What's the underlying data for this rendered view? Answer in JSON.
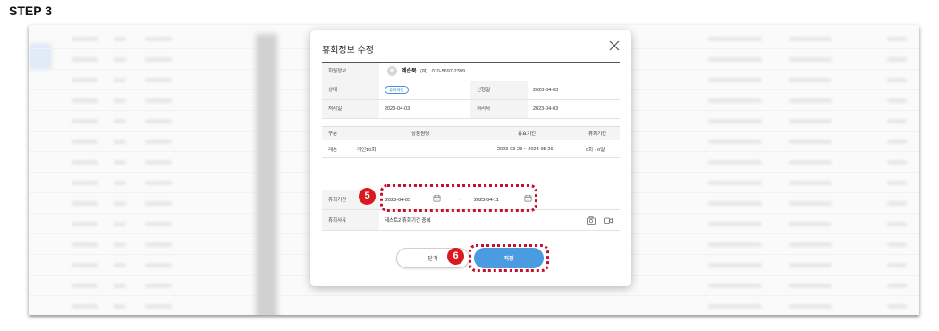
{
  "step_label": "STEP 3",
  "modal": {
    "title": "휴회정보 수정",
    "member_label": "회원정보",
    "member_name": "레슨북",
    "member_suffix": "(여)",
    "member_phone": "010-5697-2399",
    "status_label": "상태",
    "status_value": "휴회예정",
    "apply_date_label": "신청일",
    "apply_date_value": "2023-04-03",
    "process_date_label": "처리일",
    "process_date_value": "2023-04-03",
    "processor_label": "처리자",
    "processor_value": "2023-04-03",
    "table": {
      "headers": [
        "구분",
        "상품권명",
        "유효기간",
        "휴회기간"
      ],
      "rows": [
        [
          "레슨",
          "개인10회",
          "2023-03-28 ~ 2023-05-26",
          "0회 · 0일"
        ]
      ]
    },
    "pause_period_label": "휴회기간",
    "pause_start": "2023-04-05",
    "pause_separator": "~",
    "pause_end": "2023-04-11",
    "pause_reason_label": "휴회사유",
    "pause_reason_value": "테스트2 휴회기간 중복",
    "close_button": "닫기",
    "save_button": "저장"
  },
  "markers": {
    "date_range": "5",
    "save": "6"
  },
  "colors": {
    "accent": "#4a9be0",
    "highlight": "#c8102e",
    "marker": "#d8191f"
  }
}
